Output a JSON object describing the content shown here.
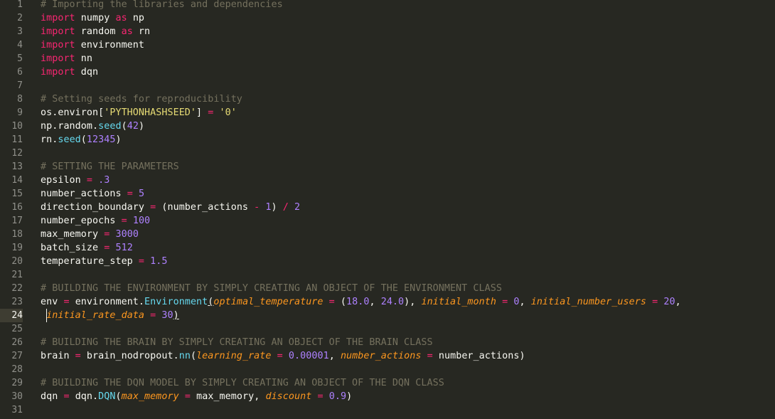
{
  "editor": {
    "theme": {
      "background": "#272822",
      "keyword": "#f92672",
      "comment": "#75715e",
      "string": "#e6db74",
      "number": "#ae81ff",
      "function": "#66d9ef",
      "parameter": "#fd971f",
      "text": "#f8f8f2"
    },
    "active_line": 24,
    "lines": [
      {
        "n": "1",
        "tokens": [
          [
            "cm",
            "# Importing the libraries and dependencies"
          ]
        ]
      },
      {
        "n": "2",
        "tokens": [
          [
            "kw",
            "import"
          ],
          [
            "",
            " numpy "
          ],
          [
            "kw",
            "as"
          ],
          [
            "",
            " np"
          ]
        ]
      },
      {
        "n": "3",
        "tokens": [
          [
            "kw",
            "import"
          ],
          [
            "",
            " random "
          ],
          [
            "kw",
            "as"
          ],
          [
            "",
            " rn"
          ]
        ]
      },
      {
        "n": "4",
        "tokens": [
          [
            "kw",
            "import"
          ],
          [
            "",
            " environment"
          ]
        ]
      },
      {
        "n": "5",
        "tokens": [
          [
            "kw",
            "import"
          ],
          [
            "",
            " nn"
          ]
        ]
      },
      {
        "n": "6",
        "tokens": [
          [
            "kw",
            "import"
          ],
          [
            "",
            " dqn"
          ]
        ]
      },
      {
        "n": "7",
        "tokens": []
      },
      {
        "n": "8",
        "tokens": [
          [
            "cm",
            "# Setting seeds for reproducibility"
          ]
        ]
      },
      {
        "n": "9",
        "tokens": [
          [
            "",
            "os.environ["
          ],
          [
            "st",
            "'PYTHONHASHSEED'"
          ],
          [
            "",
            "] "
          ],
          [
            "op",
            "="
          ],
          [
            "",
            " "
          ],
          [
            "st",
            "'0'"
          ]
        ]
      },
      {
        "n": "10",
        "tokens": [
          [
            "",
            "np.random."
          ],
          [
            "fn",
            "seed"
          ],
          [
            "",
            "("
          ],
          [
            "nu",
            "42"
          ],
          [
            "",
            ")"
          ]
        ]
      },
      {
        "n": "11",
        "tokens": [
          [
            "",
            "rn."
          ],
          [
            "fn",
            "seed"
          ],
          [
            "",
            "("
          ],
          [
            "nu",
            "12345"
          ],
          [
            "",
            ")"
          ]
        ]
      },
      {
        "n": "12",
        "tokens": []
      },
      {
        "n": "13",
        "tokens": [
          [
            "cm",
            "# SETTING THE PARAMETERS"
          ]
        ]
      },
      {
        "n": "14",
        "tokens": [
          [
            "",
            "epsilon "
          ],
          [
            "op",
            "="
          ],
          [
            "",
            " "
          ],
          [
            "nu",
            ".3"
          ]
        ]
      },
      {
        "n": "15",
        "tokens": [
          [
            "",
            "number_actions "
          ],
          [
            "op",
            "="
          ],
          [
            "",
            " "
          ],
          [
            "nu",
            "5"
          ]
        ]
      },
      {
        "n": "16",
        "tokens": [
          [
            "",
            "direction_boundary "
          ],
          [
            "op",
            "="
          ],
          [
            "",
            " (number_actions "
          ],
          [
            "op",
            "-"
          ],
          [
            "",
            " "
          ],
          [
            "nu",
            "1"
          ],
          [
            "",
            ") "
          ],
          [
            "op",
            "/"
          ],
          [
            "",
            " "
          ],
          [
            "nu",
            "2"
          ]
        ]
      },
      {
        "n": "17",
        "tokens": [
          [
            "",
            "number_epochs "
          ],
          [
            "op",
            "="
          ],
          [
            "",
            " "
          ],
          [
            "nu",
            "100"
          ]
        ]
      },
      {
        "n": "18",
        "tokens": [
          [
            "",
            "max_memory "
          ],
          [
            "op",
            "="
          ],
          [
            "",
            " "
          ],
          [
            "nu",
            "3000"
          ]
        ]
      },
      {
        "n": "19",
        "tokens": [
          [
            "",
            "batch_size "
          ],
          [
            "op",
            "="
          ],
          [
            "",
            " "
          ],
          [
            "nu",
            "512"
          ]
        ]
      },
      {
        "n": "20",
        "tokens": [
          [
            "",
            "temperature_step "
          ],
          [
            "op",
            "="
          ],
          [
            "",
            " "
          ],
          [
            "nu",
            "1.5"
          ]
        ]
      },
      {
        "n": "21",
        "tokens": []
      },
      {
        "n": "22",
        "tokens": [
          [
            "cm",
            "# BUILDING THE ENVIRONMENT BY SIMPLY CREATING AN OBJECT OF THE ENVIRONMENT CLASS"
          ]
        ]
      },
      {
        "n": "23",
        "tokens": [
          [
            "",
            "env "
          ],
          [
            "op",
            "="
          ],
          [
            "",
            " environment."
          ],
          [
            "fn",
            "Environment"
          ],
          [
            "pn",
            "("
          ],
          [
            "pa",
            "optimal_temperature"
          ],
          [
            "",
            " "
          ],
          [
            "op",
            "="
          ],
          [
            "",
            " ("
          ],
          [
            "nu",
            "18.0"
          ],
          [
            "",
            ", "
          ],
          [
            "nu",
            "24.0"
          ],
          [
            "",
            "), "
          ],
          [
            "pa",
            "initial_month"
          ],
          [
            "",
            " "
          ],
          [
            "op",
            "="
          ],
          [
            "",
            " "
          ],
          [
            "nu",
            "0"
          ],
          [
            "",
            ", "
          ],
          [
            "pa",
            "initial_number_users"
          ],
          [
            "",
            " "
          ],
          [
            "op",
            "="
          ],
          [
            "",
            " "
          ],
          [
            "nu",
            "20"
          ],
          [
            "",
            ","
          ]
        ]
      },
      {
        "n": "24",
        "tokens": [
          [
            "",
            " "
          ],
          [
            "pa",
            "initial_rate_data"
          ],
          [
            "",
            " "
          ],
          [
            "op",
            "="
          ],
          [
            "",
            " "
          ],
          [
            "nu",
            "30"
          ],
          [
            "pn",
            ")"
          ]
        ]
      },
      {
        "n": "25",
        "tokens": []
      },
      {
        "n": "26",
        "tokens": [
          [
            "cm",
            "# BUILDING THE BRAIN BY SIMPLY CREATING AN OBJECT OF THE BRAIN CLASS"
          ]
        ]
      },
      {
        "n": "27",
        "tokens": [
          [
            "",
            "brain "
          ],
          [
            "op",
            "="
          ],
          [
            "",
            " brain_nodropout."
          ],
          [
            "fn",
            "nn"
          ],
          [
            "",
            "("
          ],
          [
            "pa",
            "learning_rate"
          ],
          [
            "",
            " "
          ],
          [
            "op",
            "="
          ],
          [
            "",
            " "
          ],
          [
            "nu",
            "0.00001"
          ],
          [
            "",
            ", "
          ],
          [
            "pa",
            "number_actions"
          ],
          [
            "",
            " "
          ],
          [
            "op",
            "="
          ],
          [
            "",
            " number_actions)"
          ]
        ]
      },
      {
        "n": "28",
        "tokens": []
      },
      {
        "n": "29",
        "tokens": [
          [
            "cm",
            "# BUILDING THE DQN MODEL BY SIMPLY CREATING AN OBJECT OF THE DQN CLASS"
          ]
        ]
      },
      {
        "n": "30",
        "tokens": [
          [
            "",
            "dqn "
          ],
          [
            "op",
            "="
          ],
          [
            "",
            " dqn."
          ],
          [
            "fn",
            "DQN"
          ],
          [
            "",
            "("
          ],
          [
            "pa",
            "max_memory"
          ],
          [
            "",
            " "
          ],
          [
            "op",
            "="
          ],
          [
            "",
            " max_memory, "
          ],
          [
            "pa",
            "discount"
          ],
          [
            "",
            " "
          ],
          [
            "op",
            "="
          ],
          [
            "",
            " "
          ],
          [
            "nu",
            "0.9"
          ],
          [
            "",
            ")"
          ]
        ]
      },
      {
        "n": "31",
        "tokens": []
      }
    ]
  }
}
